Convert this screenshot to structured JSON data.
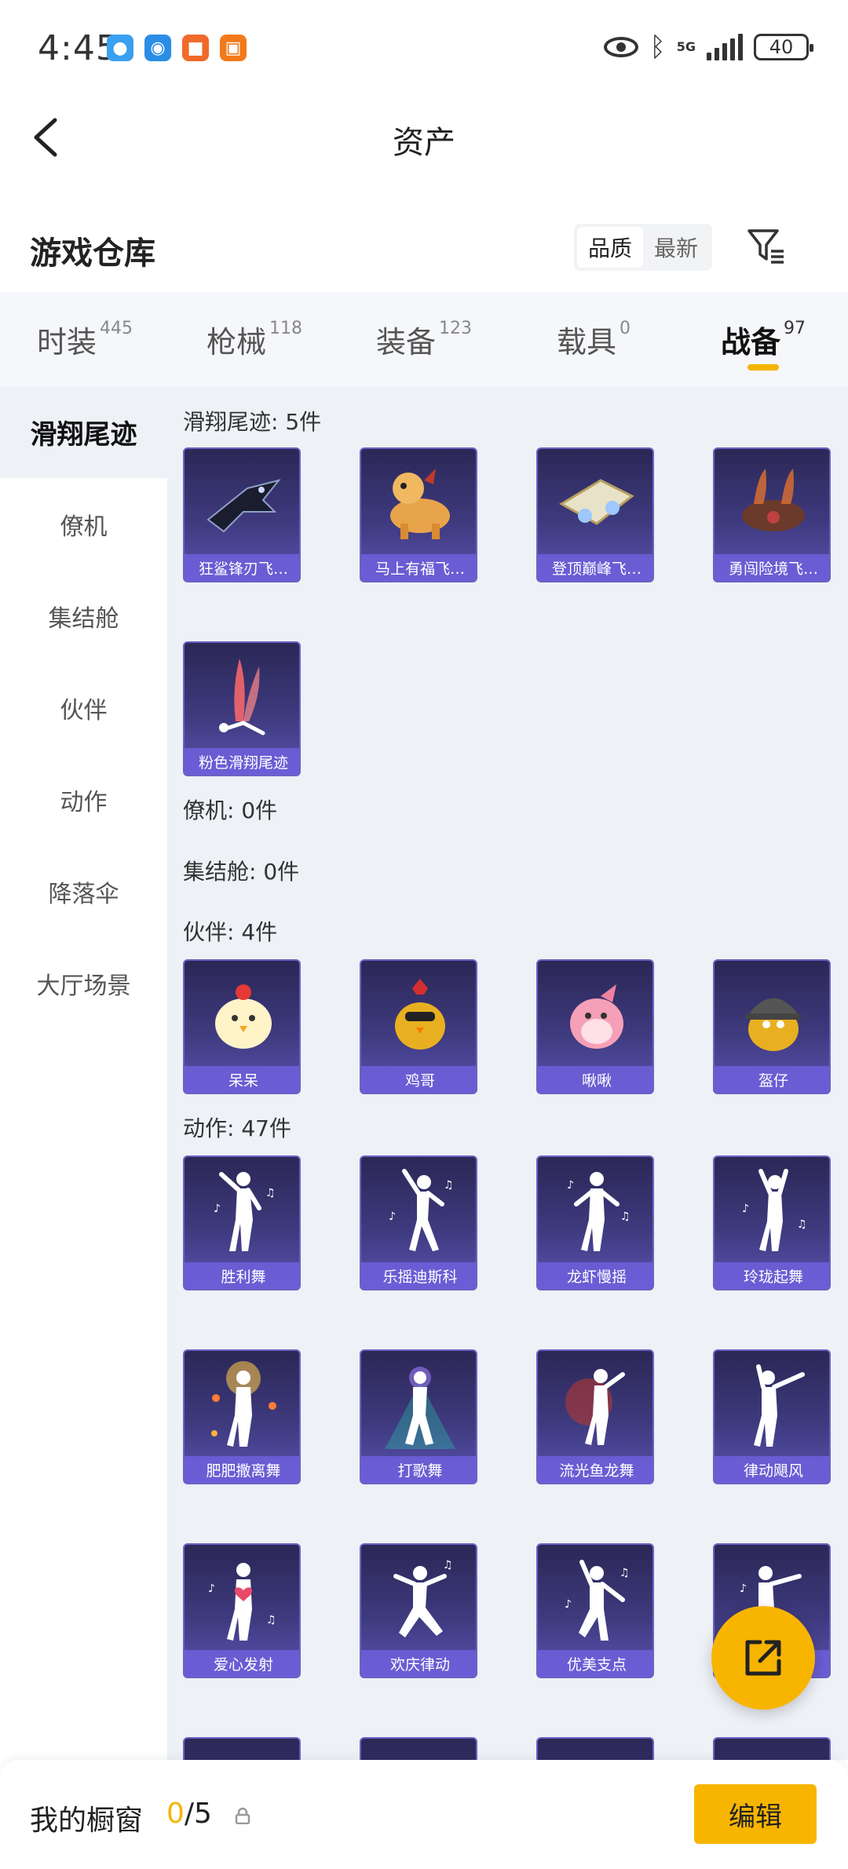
{
  "status": {
    "time": "4:45",
    "network": "5G",
    "battery": "40"
  },
  "header": {
    "title": "资产"
  },
  "warehouse": {
    "title": "游戏仓库",
    "sort_quality": "品质",
    "sort_latest": "最新"
  },
  "tabs": [
    {
      "label": "时装",
      "count": "445"
    },
    {
      "label": "枪械",
      "count": "118"
    },
    {
      "label": "装备",
      "count": "123"
    },
    {
      "label": "载具",
      "count": "0"
    },
    {
      "label": "战备",
      "count": "97"
    }
  ],
  "sidebar": [
    {
      "label": "滑翔尾迹"
    },
    {
      "label": "僚机"
    },
    {
      "label": "集结舱"
    },
    {
      "label": "伙伴"
    },
    {
      "label": "动作"
    },
    {
      "label": "降落伞"
    },
    {
      "label": "大厅场景"
    }
  ],
  "sections": {
    "trail": "滑翔尾迹: 5件",
    "wingman": "僚机: 0件",
    "pod": "集结舱: 0件",
    "partner": "伙伴: 4件",
    "emote": "动作: 47件"
  },
  "items": {
    "trail": [
      "狂鲨锋刃飞…",
      "马上有福飞…",
      "登顶巅峰飞…",
      "勇闯险境飞…",
      "粉色滑翔尾迹"
    ],
    "partner": [
      "呆呆",
      "鸡哥",
      "啾啾",
      "盔仔"
    ],
    "emote": [
      "胜利舞",
      "乐摇迪斯科",
      "龙虾慢摇",
      "玲珑起舞",
      "肥肥撒离舞",
      "打歌舞",
      "流光鱼龙舞",
      "律动飓风",
      "爱心发射",
      "欢庆律动",
      "优美支点"
    ]
  },
  "bottom": {
    "title": "我的橱窗",
    "count_current": "0",
    "count_total": "/5",
    "edit_label": "编辑"
  },
  "colors": {
    "accent": "#f7b500",
    "card_bg": "#3e3a7e",
    "card_label": "#6e5fdc"
  }
}
